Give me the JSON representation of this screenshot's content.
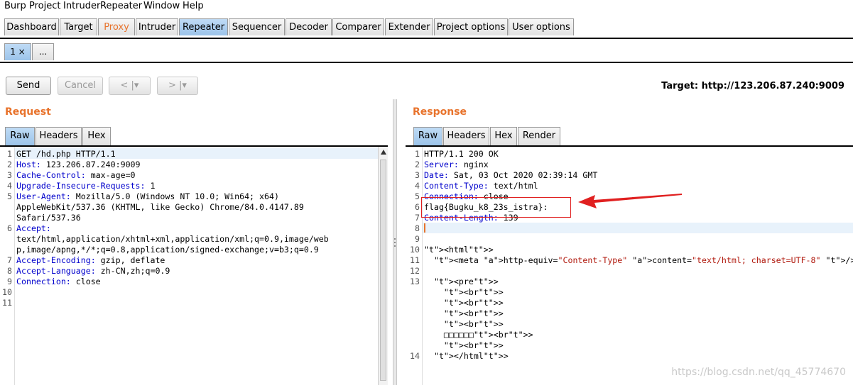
{
  "menu": [
    "Burp",
    "Project",
    "Intruder",
    "Repeater",
    "Window",
    "Help"
  ],
  "tabs": [
    "Dashboard",
    "Target",
    "Proxy",
    "Intruder",
    "Repeater",
    "Sequencer",
    "Decoder",
    "Comparer",
    "Extender",
    "Project options",
    "User options"
  ],
  "repeater_tabs": [
    "1 ×",
    "..."
  ],
  "toolbar": {
    "send": "Send",
    "cancel": "Cancel",
    "back": "< |▾",
    "forward": "> |▾"
  },
  "target": "Target: http://123.206.87.240:9009",
  "request": {
    "title": "Request",
    "view_tabs": [
      "Raw",
      "Headers",
      "Hex"
    ],
    "line_numbers": [
      "1",
      "2",
      "3",
      "4",
      "5",
      "",
      "",
      "6",
      "",
      "",
      "7",
      "8",
      "9",
      "10",
      "11"
    ],
    "lines": [
      "GET /hd.php HTTP/1.1",
      "Host: 123.206.87.240:9009",
      "Cache-Control: max-age=0",
      "Upgrade-Insecure-Requests: 1",
      "User-Agent: Mozilla/5.0 (Windows NT 10.0; Win64; x64)",
      "AppleWebKit/537.36 (KHTML, like Gecko) Chrome/84.0.4147.89",
      "Safari/537.36",
      "Accept:",
      "text/html,application/xhtml+xml,application/xml;q=0.9,image/web",
      "p,image/apng,*/*;q=0.8,application/signed-exchange;v=b3;q=0.9",
      "Accept-Encoding: gzip, deflate",
      "Accept-Language: zh-CN,zh;q=0.9",
      "Connection: close",
      "",
      ""
    ]
  },
  "response": {
    "title": "Response",
    "view_tabs": [
      "Raw",
      "Headers",
      "Hex",
      "Render"
    ],
    "line_numbers": [
      "1",
      "2",
      "3",
      "4",
      "5",
      "6",
      "7",
      "8",
      "9",
      "10",
      "11",
      "12",
      "13",
      "",
      "",
      "",
      "",
      "",
      "",
      "14"
    ],
    "lines": [
      "HTTP/1.1 200 OK",
      "Server: nginx",
      "Date: Sat, 03 Oct 2020 02:39:14 GMT",
      "Content-Type: text/html",
      "Connection: close",
      "flag{Bugku_k8_23s_istra}:",
      "Content-Length: 139",
      "",
      "",
      "<html>",
      "  <meta http-equiv=\"Content-Type\" content=\"text/html; charset=UTF-8\" />",
      "",
      "  <pre>",
      "    <br>",
      "    <br>",
      "    <br>",
      "    <br>",
      "    □□□□□□<br>",
      "    <br>",
      "  </html>"
    ]
  },
  "watermark": "https://blog.csdn.net/qq_45774670",
  "colors": {
    "accent": "#e8732c",
    "tab_active": "#9cc4ea",
    "annotation": "#e02020"
  }
}
